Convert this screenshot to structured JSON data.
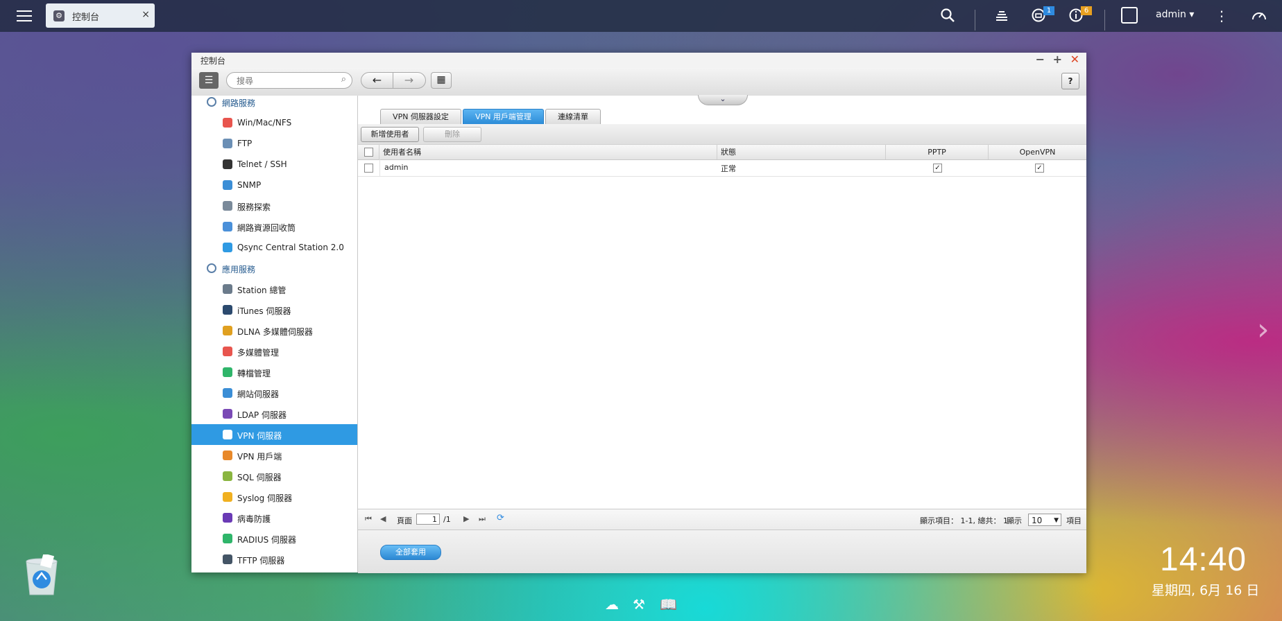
{
  "topbar": {
    "app_tab_label": "控制台",
    "tab_close": "×",
    "notification_badge": "1",
    "info_badge": "6",
    "username": "admin ▾"
  },
  "window": {
    "title": "控制台",
    "search_placeholder": "搜尋",
    "help_label": "?"
  },
  "sidebar": {
    "items": [
      {
        "label": "網路服務",
        "type": "category",
        "icon": "globe-icon",
        "color": "#5a7fa8"
      },
      {
        "label": "Win/Mac/NFS",
        "icon": "triangle-icon",
        "color": "#e8554e"
      },
      {
        "label": "FTP",
        "icon": "folder-icon",
        "color": "#6b8fb5"
      },
      {
        "label": "Telnet / SSH",
        "icon": "terminal-icon",
        "color": "#333333"
      },
      {
        "label": "SNMP",
        "icon": "bar-chart-icon",
        "color": "#3b8ed6"
      },
      {
        "label": "服務探索",
        "icon": "satellite-icon",
        "color": "#7a8a9a"
      },
      {
        "label": "網路資源回收筒",
        "icon": "recycle-icon",
        "color": "#4a90d9"
      },
      {
        "label": "Qsync Central Station 2.0",
        "icon": "sync-icon",
        "color": "#2f9ae3"
      },
      {
        "label": "應用服務",
        "type": "category",
        "icon": "drive-icon",
        "color": "#5a7fa8"
      },
      {
        "label": "Station 總管",
        "icon": "station-icon",
        "color": "#6b7b8b"
      },
      {
        "label": "iTunes 伺服器",
        "icon": "itunes-icon",
        "color": "#2c4a6e"
      },
      {
        "label": "DLNA 多媒體伺服器",
        "icon": "dlna-icon",
        "color": "#e0a020"
      },
      {
        "label": "多媒體管理",
        "icon": "media-icon",
        "color": "#e8554e"
      },
      {
        "label": "轉檔管理",
        "icon": "transcode-icon",
        "color": "#2fb56a"
      },
      {
        "label": "網站伺服器",
        "icon": "web-icon",
        "color": "#3b8ed6"
      },
      {
        "label": "LDAP 伺服器",
        "icon": "ldap-icon",
        "color": "#7a4ab5"
      },
      {
        "label": "VPN 伺服器",
        "icon": "vpn-server-icon",
        "color": "#ffffff",
        "selected": true
      },
      {
        "label": "VPN 用戶端",
        "icon": "vpn-client-icon",
        "color": "#e8892a"
      },
      {
        "label": "SQL 伺服器",
        "icon": "database-icon",
        "color": "#8ab540"
      },
      {
        "label": "Syslog 伺服器",
        "icon": "mail-icon",
        "color": "#f0b020"
      },
      {
        "label": "病毒防護",
        "icon": "antivirus-icon",
        "color": "#6a3ab5"
      },
      {
        "label": "RADIUS 伺服器",
        "icon": "wifi-icon",
        "color": "#2fb56a"
      },
      {
        "label": "TFTP 伺服器",
        "icon": "tftp-icon",
        "color": "#445566"
      }
    ]
  },
  "main": {
    "tabs": [
      {
        "label": "VPN 伺服器設定"
      },
      {
        "label": "VPN 用戶端管理",
        "active": true
      },
      {
        "label": "連線清單"
      }
    ],
    "add_user_label": "新增使用者",
    "delete_label": "刪除",
    "table": {
      "headers": [
        "使用者名稱",
        "狀態",
        "PPTP",
        "OpenVPN"
      ],
      "rows": [
        {
          "username": "admin",
          "status": "正常",
          "pptp": "✓",
          "openvpn": "✓"
        }
      ]
    },
    "pager": {
      "page_label": "頁面",
      "page_value": "1",
      "total_pages": "/1",
      "display_info": "顯示項目： 1-1, 總共： 1",
      "show_label": "顯示",
      "per_page": "10",
      "items_label": "項目"
    },
    "apply_all_label": "全部套用"
  },
  "desktop": {
    "time": "14:40",
    "date": "星期四, 6月 16 日"
  }
}
